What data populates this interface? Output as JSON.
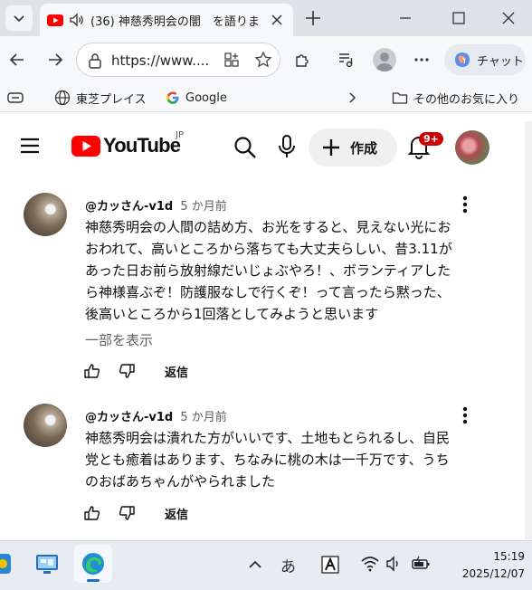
{
  "browser": {
    "tab_title": "(36) 神慈秀明会の闇　を語りま",
    "url": "https://www....",
    "chat_label": "チャット",
    "favorites": [
      {
        "label": "東芝プレイス",
        "icon": "globe-icon"
      },
      {
        "label": "Google",
        "icon": "google-icon"
      }
    ],
    "other_favorites": "その他のお気に入り"
  },
  "youtube": {
    "logo_text": "YouTube",
    "region": "JP",
    "create_label": "作成",
    "notification_count": "9+"
  },
  "comments": [
    {
      "author": "@カッさん-v1d",
      "time": "5 か月前",
      "lines": [
        "神慈秀明会の人間の詰め方、お光をすると、見えない光にお",
        "おわれて、高いところから落ちても大丈夫らしい、昔3.11が",
        "あった日お前ら放射線だいじょぶやろ！、ボランティアした",
        "ら神様喜ぶぞ！防護服なしで行くぞ！って言ったら黙った、",
        "後高いところから1回落としてみようと思います"
      ],
      "show_more": "一部を表示",
      "reply_label": "返信"
    },
    {
      "author": "@カッさん-v1d",
      "time": "5 か月前",
      "lines": [
        "神慈秀明会は潰れた方がいいです、土地もとられるし、自民",
        "党とも癒着はあります、ちなみに桃の木は一千万です、うち",
        "のおばあちゃんがやられました"
      ],
      "reply_label": "返信"
    }
  ],
  "taskbar": {
    "ime": "あ",
    "time": "15:19",
    "date": "2025/12/07"
  },
  "colors": {
    "youtube_red": "#ff0000",
    "badge_red": "#cc0000",
    "copilot_gradient": "#5b8def"
  }
}
